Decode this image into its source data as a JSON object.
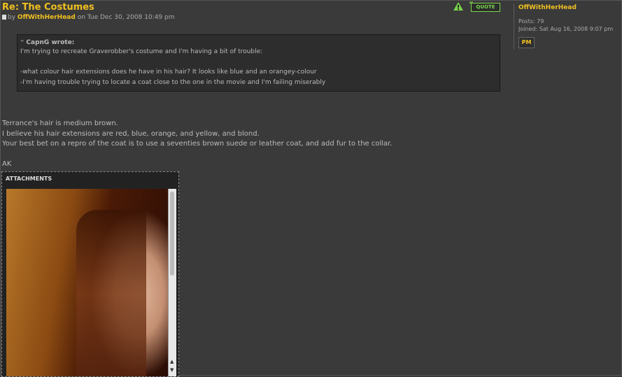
{
  "post": {
    "title": "Re: The Costumes",
    "by_label": "by",
    "author": "OffWithHerHead",
    "date": "on Tue Dec 30, 2008 10:49 pm",
    "quote_button": "QUOTE",
    "quote": {
      "cite": "CapnG wrote:",
      "line1": "I'm trying to recreate Graverobber's costume and I'm having a bit of trouble:",
      "line2": "-what colour hair extensions does he have in his hair? It looks like blue and an orangey-colour",
      "line3": "-I'm having trouble trying to locate a coat close to the one in the movie and I'm failing miserably"
    },
    "body": [
      "Terrance's hair is medium brown.",
      "I believe his hair extensions are red, blue, orange, and yellow, and blond.",
      "Your best bet on a repro of the coat is to use a seventies brown suede or leather coat, and add fur to the collar.",
      "AK"
    ],
    "attachments_label": "ATTACHMENTS"
  },
  "profile": {
    "name": "OffWithHerHead",
    "posts": "Posts: 79",
    "joined": "Joined: Sat Aug 16, 2008 9:07 pm",
    "pm_label": "PM"
  },
  "colors": {
    "accent": "#f0c020",
    "quote_green": "#7ad44a",
    "background": "#3a3a3a"
  }
}
